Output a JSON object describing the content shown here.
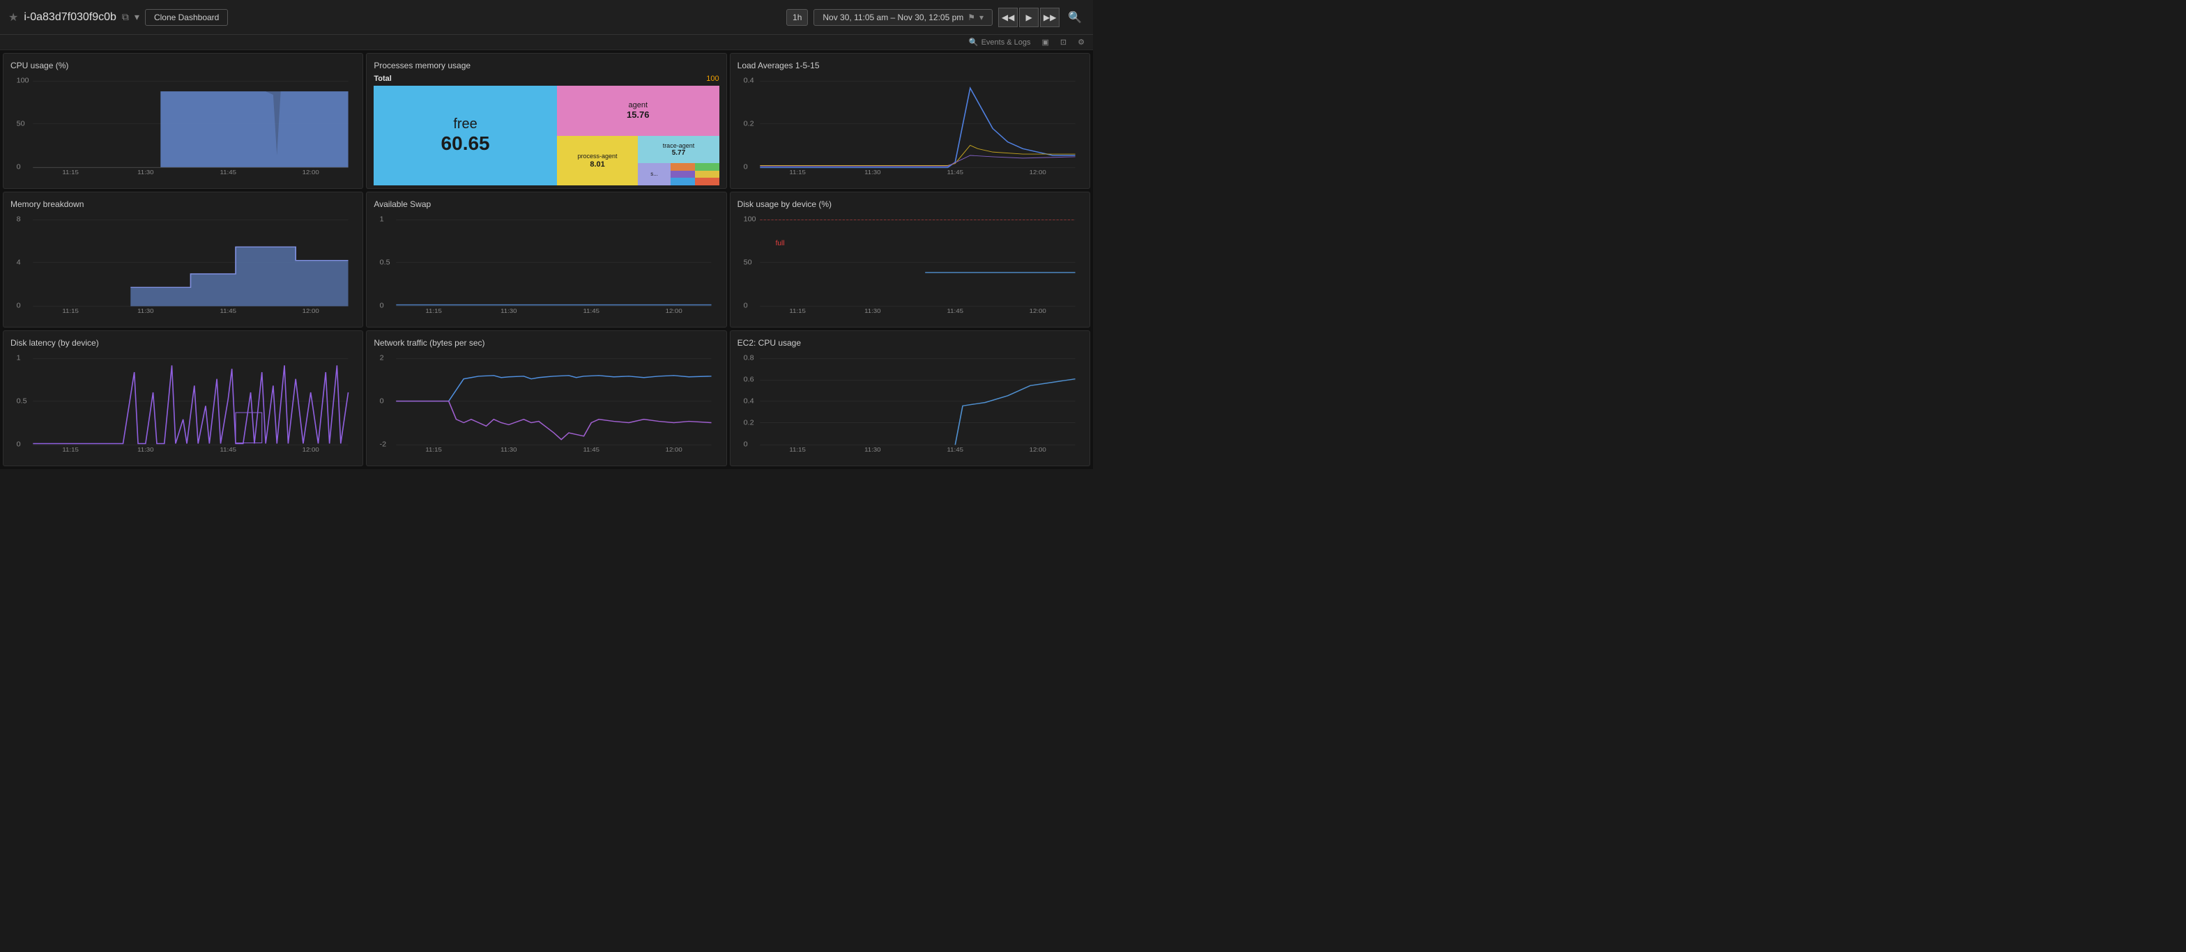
{
  "header": {
    "star_icon": "★",
    "title": "i-0a83d7f030f9c0b",
    "copy_icon": "⧉",
    "chevron_icon": "▾",
    "clone_btn": "Clone Dashboard",
    "time_period": "1h",
    "time_range": "Nov 30, 11:05 am – Nov 30, 12:05 pm",
    "flag_icon": "⚑",
    "dropdown_icon": "▾",
    "rewind_icon": "◀◀",
    "play_icon": "▶",
    "forward_icon": "▶▶",
    "search_icon": "🔍"
  },
  "sub_header": {
    "events_logs": "Events & Logs",
    "icon1": "▣",
    "icon2": "⊡",
    "settings_icon": "⚙"
  },
  "widgets": {
    "cpu_usage": {
      "title": "CPU usage (%)",
      "y_max": "100",
      "y_mid": "50",
      "y_min": "0",
      "x_labels": [
        "11:15",
        "11:30",
        "11:45",
        "12:00"
      ]
    },
    "processes_memory": {
      "title": "Processes memory usage",
      "total_label": "Total",
      "total_value": "100",
      "free_label": "free",
      "free_value": "60.65",
      "agent_label": "agent",
      "agent_value": "15.76",
      "process_agent_label": "process-agent",
      "process_agent_value": "8.01",
      "trace_agent_label": "trace-agent",
      "trace_agent_value": "5.77",
      "s_label": "s..."
    },
    "load_averages": {
      "title": "Load Averages 1-5-15",
      "y_max": "0.4",
      "y_mid": "0.2",
      "y_min": "0",
      "x_labels": [
        "11:15",
        "11:30",
        "11:45",
        "12:00"
      ]
    },
    "memory_breakdown": {
      "title": "Memory breakdown",
      "y_max": "8",
      "y_mid": "4",
      "y_min": "0",
      "x_labels": [
        "11:15",
        "11:30",
        "11:45",
        "12:00"
      ]
    },
    "available_swap": {
      "title": "Available Swap",
      "y_max": "1",
      "y_mid": "0.5",
      "y_min": "0",
      "x_labels": [
        "11:15",
        "11:30",
        "11:45",
        "12:00"
      ]
    },
    "disk_usage": {
      "title": "Disk usage by device (%)",
      "full_label": "full",
      "y_max": "100",
      "y_mid": "50",
      "y_min": "0",
      "x_labels": [
        "11:15",
        "11:30",
        "11:45",
        "12:00"
      ]
    },
    "disk_latency": {
      "title": "Disk latency (by device)",
      "y_max": "1",
      "y_mid": "0.5",
      "y_min": "0",
      "x_labels": [
        "11:15",
        "11:30",
        "11:45",
        "12:00"
      ]
    },
    "network_traffic": {
      "title": "Network traffic (bytes per sec)",
      "y_max": "2",
      "y_mid": "0",
      "y_min": "-2",
      "x_labels": [
        "11:15",
        "11:30",
        "11:45",
        "12:00"
      ]
    },
    "ec2_cpu": {
      "title": "EC2: CPU usage",
      "y_max": "0.8",
      "y_mid_top": "0.6",
      "y_mid": "0.4",
      "y_mid_bot": "0.2",
      "y_min": "0",
      "x_labels": [
        "11:15",
        "11:30",
        "11:45",
        "12:00"
      ]
    }
  }
}
